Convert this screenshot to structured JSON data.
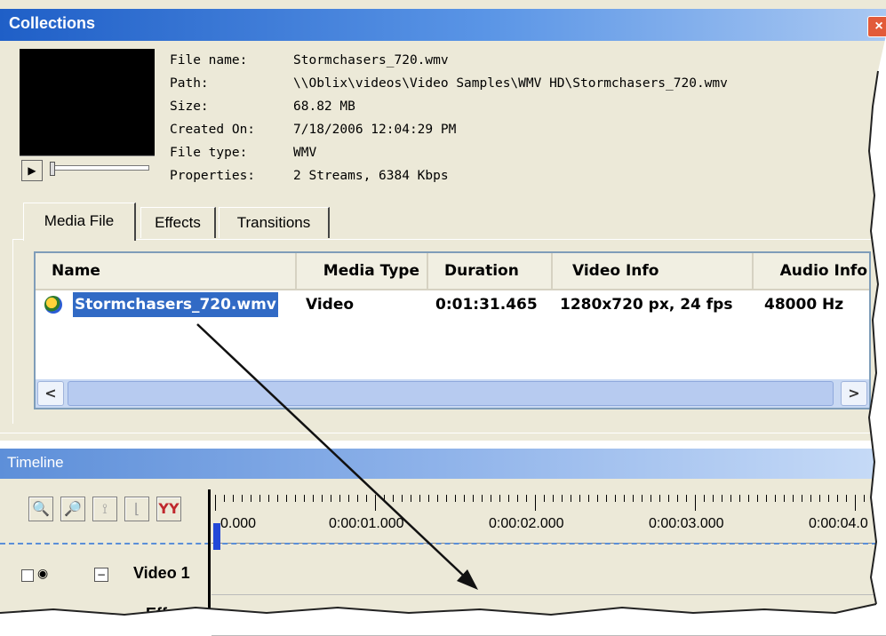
{
  "collections": {
    "title": "Collections",
    "close_glyph": "×",
    "info_labels": [
      "File name:",
      "Path:",
      "Size:",
      "Created On:",
      "File type:",
      "Properties:"
    ],
    "info_values": [
      "Stormchasers_720.wmv",
      "\\\\Oblix\\videos\\Video Samples\\WMV HD\\Stormchasers_720.wmv",
      "68.82 MB",
      "7/18/2006 12:04:29 PM",
      "WMV",
      "2 Streams, 6384 Kbps"
    ],
    "tabs": [
      "Media File",
      "Effects",
      "Transitions"
    ],
    "columns": [
      "Name",
      "Media Type",
      "Duration",
      "Video Info",
      "Audio Info"
    ],
    "rows": [
      {
        "name": "Stormchasers_720.wmv",
        "media_type": "Video",
        "duration": "0:01:31.465",
        "video_info": "1280x720 px, 24 fps",
        "audio_info": "48000 Hz"
      }
    ]
  },
  "timeline": {
    "title": "Timeline",
    "ruler_labels": [
      "0.000",
      "0:00:01.000",
      "0:00:02.000",
      "0:00:03.000",
      "0:00:04.0"
    ],
    "tracks": [
      "Video 1",
      "Effect"
    ],
    "expand_glyph": "−"
  },
  "icons": {
    "zoom_in": "zoom-in-icon",
    "zoom_out": "zoom-out-icon",
    "split_a": "split-icon",
    "split_b": "trim-icon",
    "markers": "markers-icon",
    "eye": "eye-icon",
    "play": "play-icon"
  },
  "colors": {
    "titlebar": "#1f5fc7",
    "selection": "#316ac5",
    "panel": "#ece9d8",
    "playhead": "#2348d8"
  }
}
